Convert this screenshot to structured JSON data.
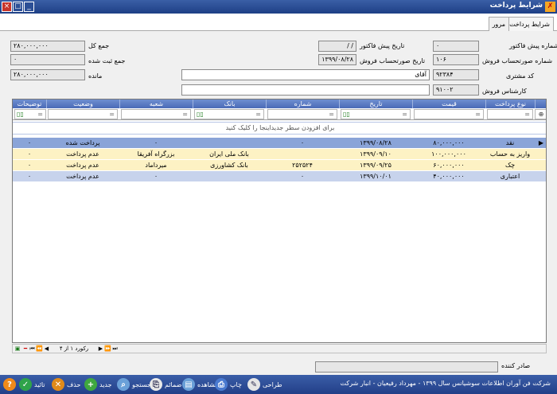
{
  "window": {
    "title": "شرایط پرداخت",
    "close": "×",
    "maximize": "□",
    "minimize": "_"
  },
  "tabs": [
    {
      "label": "شرایط پرداخت"
    },
    {
      "label": "مرور"
    }
  ],
  "form": {
    "preinvoice_no_label": "شماره پیش فاکتور",
    "preinvoice_no": "۰",
    "preinvoice_date_label": "تاریخ پیش فاکتور",
    "preinvoice_date": "/  /",
    "total_label": "جمع کل",
    "total": "۲۸۰,۰۰۰,۰۰۰",
    "sales_no_label": "شماره صورتحساب فروش",
    "sales_no": "۱۰۶",
    "sales_date_label": "تاریخ صورتحساب فروش",
    "sales_date": "۱۳۹۹/۰۸/۲۸",
    "registered_label": "جمع ثبت شده",
    "registered": "۰",
    "customer_code_label": "کد مشتری",
    "customer_code": "۹۲۳۸۴",
    "customer_name": "آقای",
    "remaining_label": "مانده",
    "remaining": "۲۸۰,۰۰۰,۰۰۰",
    "expert_label": "کارشناس فروش",
    "expert_code": "۹۱۰۰۲",
    "issuer_label": "صادر کننده"
  },
  "grid": {
    "columns": [
      "نوع پرداخت",
      "قیمت",
      "تاریخ",
      "شماره",
      "بانک",
      "شعبه",
      "وضعیت",
      "توضیحات"
    ],
    "add_row_text": "برای افزودن سطر جدیداینجا را کلیک کنید",
    "rows": [
      [
        "نقد",
        "۸۰,۰۰۰,۰۰۰",
        "۱۳۹۹/۰۸/۲۸",
        "۰",
        "",
        "۰",
        "پرداخت شده",
        "۰"
      ],
      [
        "واریز به حساب",
        "۱۰۰,۰۰۰,۰۰۰",
        "۱۳۹۹/۰۹/۱۰",
        "",
        "بانک ملی ایران",
        "بزرگراه آفریقا",
        "عدم پرداخت",
        "۰"
      ],
      [
        "چک",
        "۶۰,۰۰۰,۰۰۰",
        "۱۳۹۹/۰۹/۲۵",
        "۲۵۲۵۲۴",
        "بانک کشاورزی",
        "میرداماد",
        "عدم پرداخت",
        "۰"
      ],
      [
        "اعتباری",
        "۴۰,۰۰۰,۰۰۰",
        "۱۳۹۹/۱۰/۰۱",
        "۰",
        "",
        "۰",
        "عدم پرداخت",
        "۰"
      ]
    ],
    "row_colors": [
      "#8aa4d8",
      "#fdf2c4",
      "#fdf2c4",
      "#c7d3ec"
    ],
    "record_nav": "رکورد ۱ از ۴"
  },
  "toolbar": [
    {
      "label": "تائید",
      "color": "#2fa34a",
      "icon": "check-icon",
      "glyph": "✓"
    },
    {
      "label": "حذف",
      "color": "#e08a1a",
      "icon": "delete-icon",
      "glyph": "✕"
    },
    {
      "label": "جدید",
      "color": "#3fa83f",
      "icon": "plus-icon",
      "glyph": "+"
    },
    {
      "label": "جستجو",
      "color": "#6aa0d8",
      "icon": "search-icon",
      "glyph": "⌕"
    },
    {
      "label": "ضمائم",
      "color": "#e8e8e8",
      "icon": "attachment-icon",
      "glyph": "⎘"
    },
    {
      "label": "مشاهده",
      "color": "#6aa0d8",
      "icon": "view-icon",
      "glyph": "▤"
    },
    {
      "label": "چاپ",
      "color": "#4a7ad0",
      "icon": "print-icon",
      "glyph": "⎙"
    },
    {
      "label": "طراحی",
      "color": "#e6e6e6",
      "icon": "design-icon",
      "glyph": "✎"
    }
  ],
  "status_text": "شرکت فن آوران اطلاعات سوشیانس سال ۱۳۹۹ - مهرداد رفیعیان - انبار شرکت",
  "help": {
    "glyph": "?",
    "color": "#f08a1a"
  }
}
